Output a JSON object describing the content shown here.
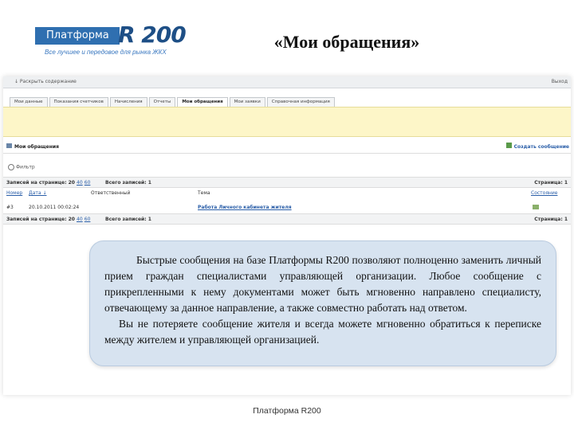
{
  "logo": {
    "word": "Платформа",
    "brand": "R 200",
    "tagline": "Все лучшее и передовое для рынка ЖКХ"
  },
  "slide_title": "«Мои обращения»",
  "app": {
    "topbar": {
      "expand_label": "↓ Раскрыть содержание",
      "right_label": "Выход"
    },
    "tabs": [
      {
        "label": "Мои данные",
        "active": false
      },
      {
        "label": "Показания счетчиков",
        "active": false
      },
      {
        "label": "Начисления",
        "active": false
      },
      {
        "label": "Отчеты",
        "active": false
      },
      {
        "label": "Мои обращения",
        "active": true
      },
      {
        "label": "Мои заявки",
        "active": false
      },
      {
        "label": "Справочная информация",
        "active": false
      }
    ],
    "section_title": "Мои обращения",
    "create_label": "Создать сообщение",
    "filter_label": "Фильтр",
    "pager_top": {
      "per_page": "Записей на странице: 20",
      "opt1": "40",
      "opt2": "60",
      "total": "Всего записей: 1",
      "page": "Страница: 1"
    },
    "pager_bottom": {
      "per_page": "Записей на странице: 20",
      "opt1": "40",
      "opt2": "60",
      "total": "Всего записей: 1",
      "page": "Страница: 1"
    },
    "columns": {
      "num": "Номер",
      "date": "Дата ↓",
      "resp": "Ответственный",
      "topic": "Тема",
      "status": "Состояние"
    },
    "rows": [
      {
        "num": "#3",
        "date": "20.10.2011 00:02:24",
        "resp": "",
        "topic": "Работа Личного кабинета жителя"
      }
    ]
  },
  "callout": {
    "p1": "Быстрые сообщения на базе Платформы R200 позволяют полноценно заменить личный прием граждан специалистами управляющей организации. Любое сообщение с прикрепленными к нему документами может быть мгновенно направлено специалисту, отвечающему за данное направление, а также совместно работать над ответом.",
    "p2": "Вы не потеряете сообщение жителя и всегда можете мгновенно обратиться к переписке между жителем и управляющей организацией."
  },
  "footer": "Платформа R200"
}
